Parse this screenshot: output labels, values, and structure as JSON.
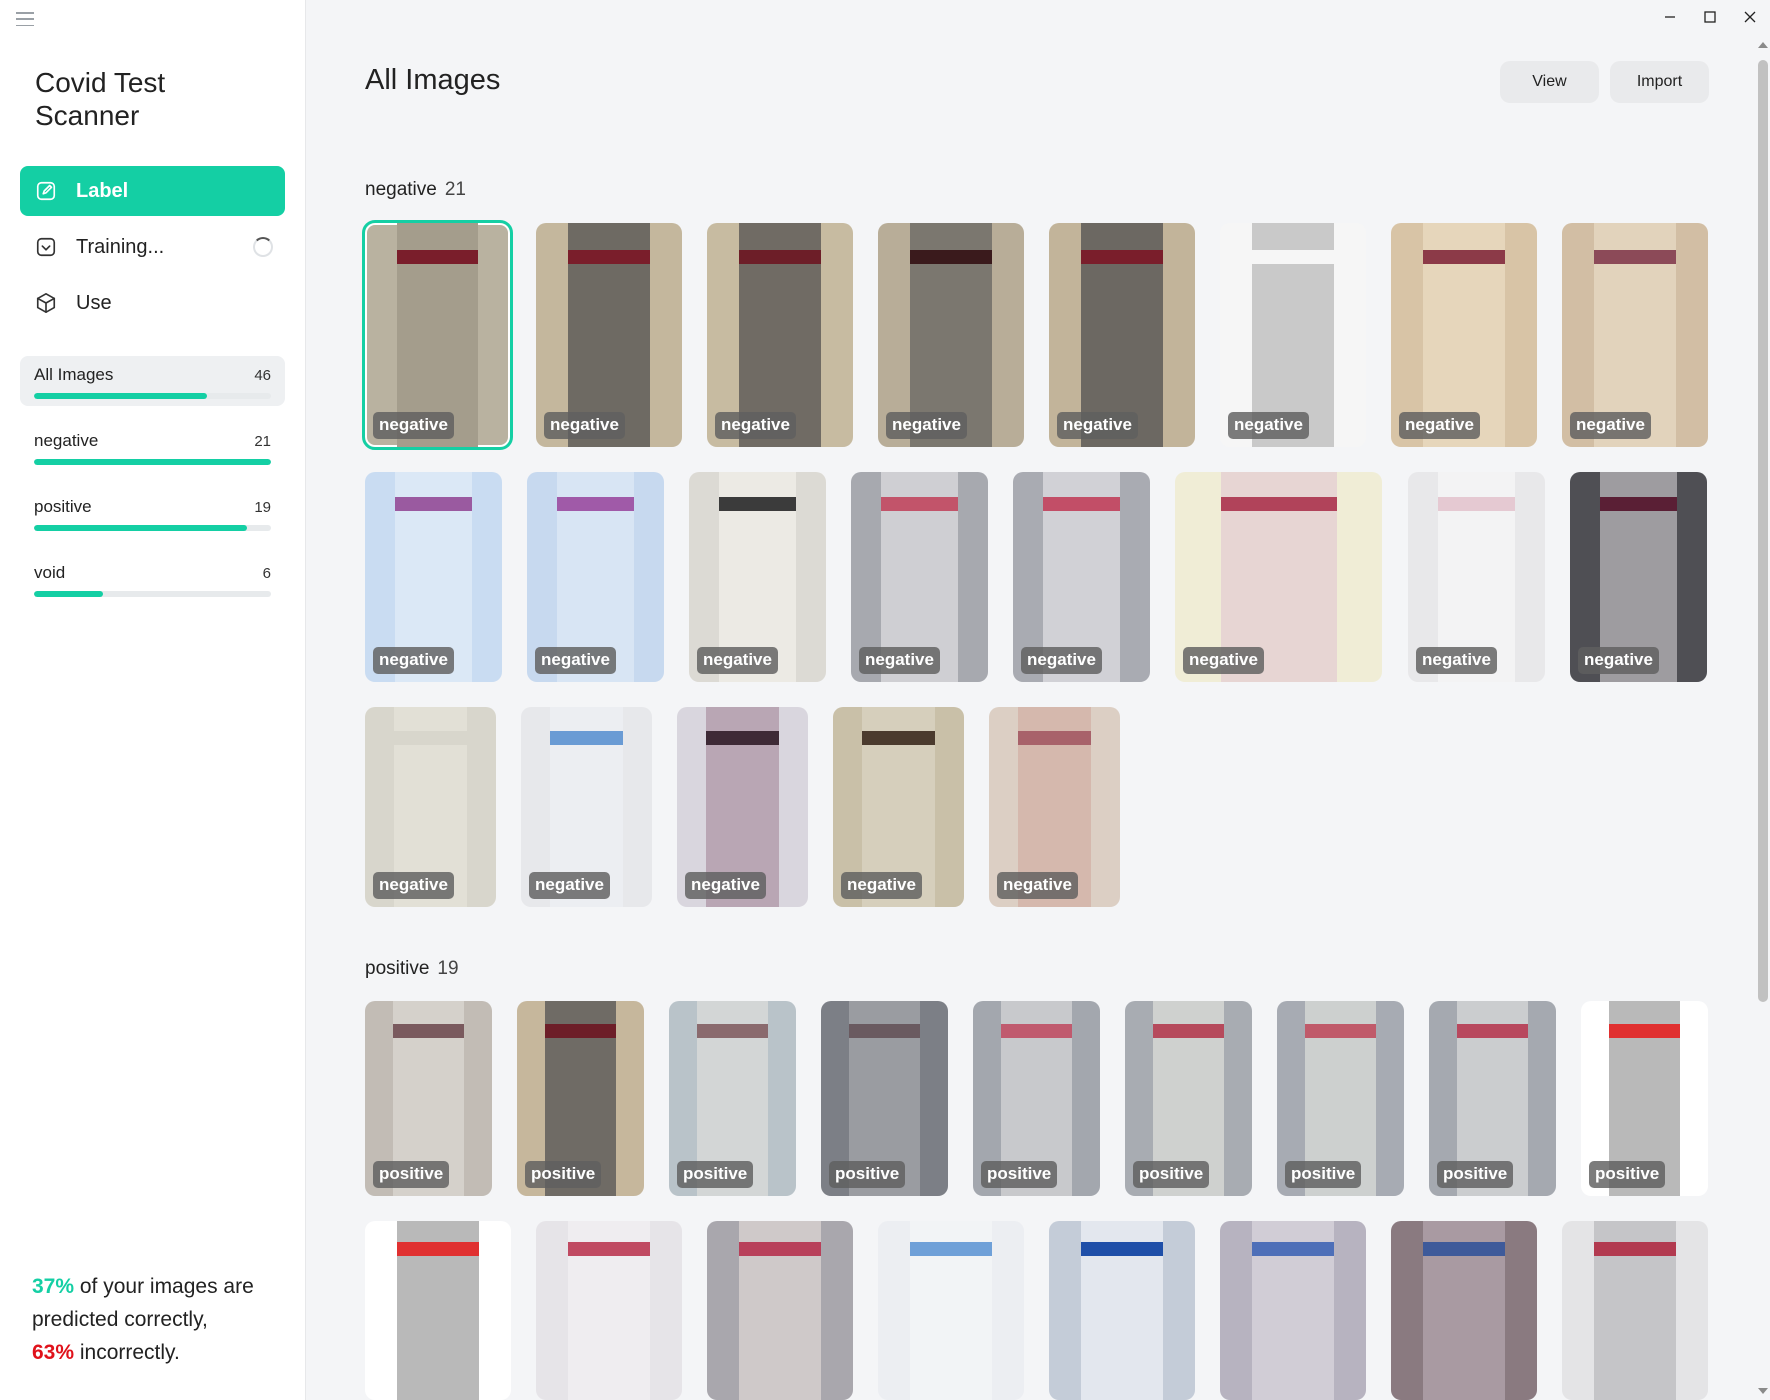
{
  "app": {
    "title": "Covid Test Scanner"
  },
  "nav": [
    {
      "label": "Label",
      "icon": "edit-icon",
      "active": true
    },
    {
      "label": "Training...",
      "icon": "checkbox-icon",
      "active": false,
      "loading": true
    },
    {
      "label": "Use",
      "icon": "cube-icon",
      "active": false
    }
  ],
  "categories": [
    {
      "name": "All Images",
      "count": "46",
      "progress": 0.73,
      "active": true
    },
    {
      "name": "negative",
      "count": "21",
      "progress": 1.0,
      "active": false
    },
    {
      "name": "positive",
      "count": "19",
      "progress": 0.9,
      "active": false
    },
    {
      "name": "void",
      "count": "6",
      "progress": 0.29,
      "active": false
    }
  ],
  "accuracy": {
    "correct": "37%",
    "incorrect": "63%",
    "text_a": " of your images are predicted correctly,",
    "text_b": " incorrectly."
  },
  "main": {
    "title": "All Images",
    "view_label": "View",
    "import_label": "Import"
  },
  "sections": [
    {
      "name": "negative",
      "count": "21"
    },
    {
      "name": "positive",
      "count": "19"
    }
  ],
  "tiles": {
    "negative": [
      {
        "label": "negative",
        "bg": "#b9b2a0",
        "strip": "#a49d8c",
        "line": "#7a1e2b"
      },
      {
        "label": "negative",
        "bg": "#c4b79d",
        "strip": "#6e6a63",
        "line": "#7a1e2b"
      },
      {
        "label": "negative",
        "bg": "#c7bba1",
        "strip": "#706b64",
        "line": "#6d1e28"
      },
      {
        "label": "negative",
        "bg": "#b8ad98",
        "strip": "#7b776f",
        "line": "#3a1a1c"
      },
      {
        "label": "negative",
        "bg": "#c2b49a",
        "strip": "#6c6862",
        "line": "#7a1e2b"
      },
      {
        "label": "negative",
        "bg": "#f6f6f6",
        "strip": "#c9c9c9",
        "line": "#f6f6f6"
      },
      {
        "label": "negative",
        "bg": "#d8c4a6",
        "strip": "#e6d6bb",
        "line": "#8c3a48"
      },
      {
        "label": "negative",
        "bg": "#d2bea4",
        "strip": "#e2d3bc",
        "line": "#8c4a58"
      },
      {
        "label": "negative",
        "bg": "#c9dcf2",
        "strip": "#dbe8f6",
        "line": "#9a5aa0"
      },
      {
        "label": "negative",
        "bg": "#c7d9ef",
        "strip": "#d8e5f4",
        "line": "#a05aa8"
      },
      {
        "label": "negative",
        "bg": "#dcdad4",
        "strip": "#eceae4",
        "line": "#3b3b3b"
      },
      {
        "label": "negative",
        "bg": "#a7a9af",
        "strip": "#cfcfd3",
        "line": "#c2546a"
      },
      {
        "label": "negative",
        "bg": "#a9abb2",
        "strip": "#d1d1d6",
        "line": "#c24e67"
      },
      {
        "label": "negative",
        "bg": "#f0edd6",
        "strip": "#e7d5d3",
        "line": "#b1435a"
      },
      {
        "label": "negative",
        "bg": "#e8e8ea",
        "strip": "#f3f3f4",
        "line": "#e5c9d2"
      },
      {
        "label": "negative",
        "bg": "#4f4f54",
        "strip": "#9e9ca0",
        "line": "#5a1f35"
      },
      {
        "label": "negative",
        "bg": "#d8d6cc",
        "strip": "#e2e0d6",
        "line": "#d8d6cc"
      },
      {
        "label": "negative",
        "bg": "#e7e8eb",
        "strip": "#eceef2",
        "line": "#6a9bd4"
      },
      {
        "label": "negative",
        "bg": "#d9d6de",
        "strip": "#b9a6b4",
        "line": "#3e2a36"
      },
      {
        "label": "negative",
        "bg": "#c9c0a8",
        "strip": "#d6cfbc",
        "line": "#4b3b2e"
      },
      {
        "label": "negative",
        "bg": "#dccfc4",
        "strip": "#d5b8ad",
        "line": "#a8626a"
      }
    ],
    "positive": [
      {
        "label": "positive",
        "bg": "#c2bcb5",
        "strip": "#d5d1cb",
        "line": "#7a5a5e"
      },
      {
        "label": "positive",
        "bg": "#c6b79c",
        "strip": "#6f6b65",
        "line": "#6d1e28"
      },
      {
        "label": "positive",
        "bg": "#b9c3c9",
        "strip": "#d3d6d6",
        "line": "#8a6a6e"
      },
      {
        "label": "positive",
        "bg": "#7c7f86",
        "strip": "#9a9ca1",
        "line": "#6a5a60"
      },
      {
        "label": "positive",
        "bg": "#a3a7ae",
        "strip": "#c8c9cc",
        "line": "#c05a6e"
      },
      {
        "label": "positive",
        "bg": "#a8acb2",
        "strip": "#cfd1cf",
        "line": "#b64a5c"
      },
      {
        "label": "positive",
        "bg": "#a7abb3",
        "strip": "#cdd0cf",
        "line": "#c05a6a"
      },
      {
        "label": "positive",
        "bg": "#a5a9b0",
        "strip": "#cbcdcf",
        "line": "#b8485e"
      },
      {
        "label": "positive",
        "bg": "#ffffff",
        "strip": "#b9b9b9",
        "line": "#e03030"
      },
      {
        "label": "",
        "bg": "#ffffff",
        "strip": "#b9b9b9",
        "line": "#e03030"
      },
      {
        "label": "",
        "bg": "#e6e4e8",
        "strip": "#efedf0",
        "line": "#c04a62"
      },
      {
        "label": "",
        "bg": "#a9a7ad",
        "strip": "#cfc9c9",
        "line": "#b8405a"
      },
      {
        "label": "",
        "bg": "#eceef2",
        "strip": "#f2f4f6",
        "line": "#6fa0d8"
      },
      {
        "label": "",
        "bg": "#c4ccd8",
        "strip": "#e3e7ee",
        "line": "#1f4fa8"
      },
      {
        "label": "",
        "bg": "#b7b3c0",
        "strip": "#d1cdd6",
        "line": "#4e6fb8"
      },
      {
        "label": "",
        "bg": "#8a7a80",
        "strip": "#a99aa2",
        "line": "#3e5a9a"
      },
      {
        "label": "",
        "bg": "#e4e4e6",
        "strip": "#c5c5c8",
        "line": "#b23a50"
      }
    ]
  }
}
